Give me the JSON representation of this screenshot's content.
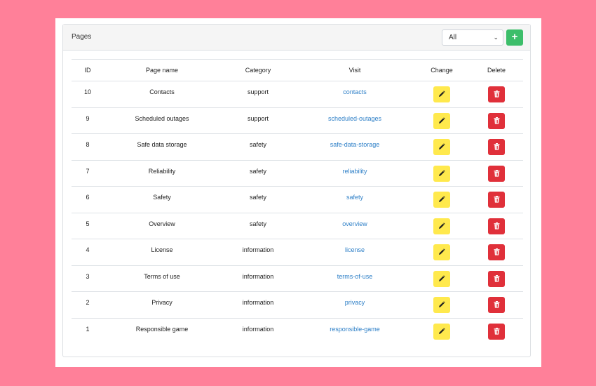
{
  "card": {
    "title": "Pages"
  },
  "filter": {
    "selected": "All"
  },
  "table": {
    "headers": {
      "id": "ID",
      "name": "Page name",
      "category": "Category",
      "visit": "Visit",
      "change": "Change",
      "delete": "Delete"
    },
    "rows": [
      {
        "id": "10",
        "name": "Contacts",
        "category": "support",
        "visit": "contacts"
      },
      {
        "id": "9",
        "name": "Scheduled outages",
        "category": "support",
        "visit": "scheduled-outages"
      },
      {
        "id": "8",
        "name": "Safe data storage",
        "category": "safety",
        "visit": "safe-data-storage"
      },
      {
        "id": "7",
        "name": "Reliability",
        "category": "safety",
        "visit": "reliability"
      },
      {
        "id": "6",
        "name": "Safety",
        "category": "safety",
        "visit": "safety"
      },
      {
        "id": "5",
        "name": "Overview",
        "category": "safety",
        "visit": "overview"
      },
      {
        "id": "4",
        "name": "License",
        "category": "information",
        "visit": "license"
      },
      {
        "id": "3",
        "name": "Terms of use",
        "category": "information",
        "visit": "terms-of-use"
      },
      {
        "id": "2",
        "name": "Privacy",
        "category": "information",
        "visit": "privacy"
      },
      {
        "id": "1",
        "name": "Responsible game",
        "category": "information",
        "visit": "responsible-game"
      }
    ]
  },
  "colors": {
    "background": "#ff8099",
    "edit": "#ffe94d",
    "delete": "#e0303a",
    "add": "#3dbe6a",
    "link": "#2d7fc7"
  },
  "icons": {
    "add": "plus-icon",
    "edit": "pencil-icon",
    "delete": "trash-icon",
    "select": "chevron-down-icon"
  }
}
